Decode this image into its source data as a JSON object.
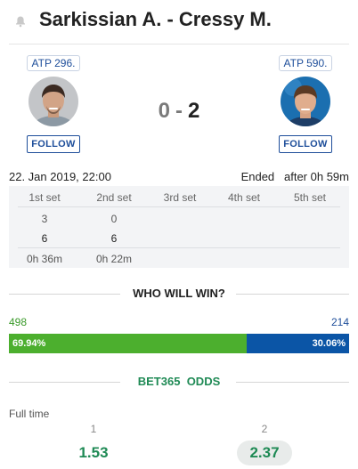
{
  "header": {
    "title": "Sarkissian A. - Cressy M."
  },
  "home": {
    "rank": "ATP 296.",
    "follow": "FOLLOW"
  },
  "away": {
    "rank": "ATP 590.",
    "follow": "FOLLOW"
  },
  "score": {
    "home": "0",
    "separator": "-",
    "away": "2"
  },
  "match": {
    "date": "22. Jan 2019, 22:00",
    "status": "Ended",
    "duration": "after 0h 59m"
  },
  "sets": {
    "headers": [
      "1st set",
      "2nd set",
      "3rd set",
      "4th set",
      "5th set"
    ],
    "home_games": [
      "3",
      "0"
    ],
    "away_games": [
      "6",
      "6"
    ],
    "times": [
      "0h 36m",
      "0h 22m"
    ]
  },
  "vote": {
    "title": "WHO WILL WIN?",
    "home_votes": "498",
    "away_votes": "214",
    "home_pct_label": "69.94%",
    "away_pct_label": "30.06%",
    "home_share": 69.94,
    "colors": {
      "home": "#4caf2e",
      "away": "#0b55a6"
    }
  },
  "odds": {
    "title_brand": "BET365",
    "title_word": "ODDS",
    "label": "Full time",
    "columns": [
      {
        "num": "1",
        "value": "1.53",
        "selected": false
      },
      {
        "num": "2",
        "value": "2.37",
        "selected": true
      }
    ]
  },
  "icons": {
    "bell": "bell-icon"
  }
}
